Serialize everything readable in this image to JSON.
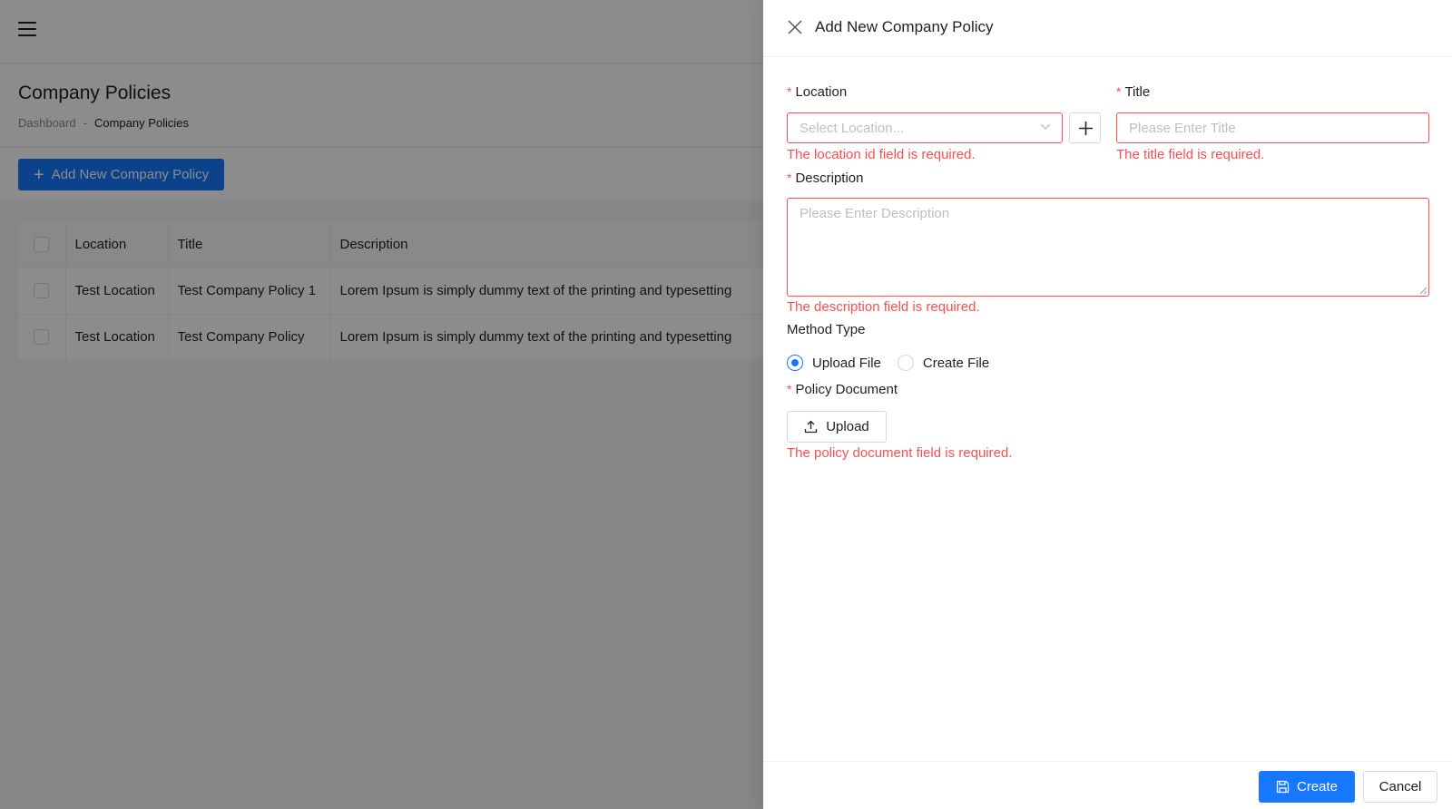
{
  "page": {
    "title": "Company Policies",
    "breadcrumb": [
      "Dashboard",
      "-",
      "Company Policies"
    ],
    "add_button_label": "Add New Company Policy"
  },
  "table": {
    "headers": [
      "Location",
      "Title",
      "Description"
    ],
    "rows": [
      {
        "location": "Test Location",
        "title": "Test Company Policy 1",
        "description": "Lorem Ipsum is simply dummy text of the printing and typesetting"
      },
      {
        "location": "Test Location",
        "title": "Test Company Policy",
        "description": "Lorem Ipsum is simply dummy text of the printing and typesetting"
      }
    ]
  },
  "drawer": {
    "title": "Add New Company Policy",
    "required_mark": "*",
    "location": {
      "label": "Location",
      "placeholder": "Select Location...",
      "error": "The location id field is required."
    },
    "title_field": {
      "label": "Title",
      "placeholder": "Please Enter Title",
      "error": "The title field is required."
    },
    "description": {
      "label": "Description",
      "placeholder": "Please Enter Description",
      "error": "The description field is required."
    },
    "method_type": {
      "label": "Method Type",
      "options": [
        "Upload File",
        "Create File"
      ],
      "selected": "Upload File"
    },
    "policy_document": {
      "label": "Policy Document",
      "upload_label": "Upload",
      "error": "The policy document field is required."
    },
    "footer": {
      "create_label": "Create",
      "cancel_label": "Cancel"
    }
  },
  "colors": {
    "primary": "#1677ff",
    "error": "#ff4d4f",
    "overlay": "rgba(0,0,0,0.45)"
  },
  "icons": [
    "hamburger-icon",
    "plus-icon",
    "close-icon",
    "chevron-down-icon",
    "upload-icon",
    "save-icon"
  ]
}
